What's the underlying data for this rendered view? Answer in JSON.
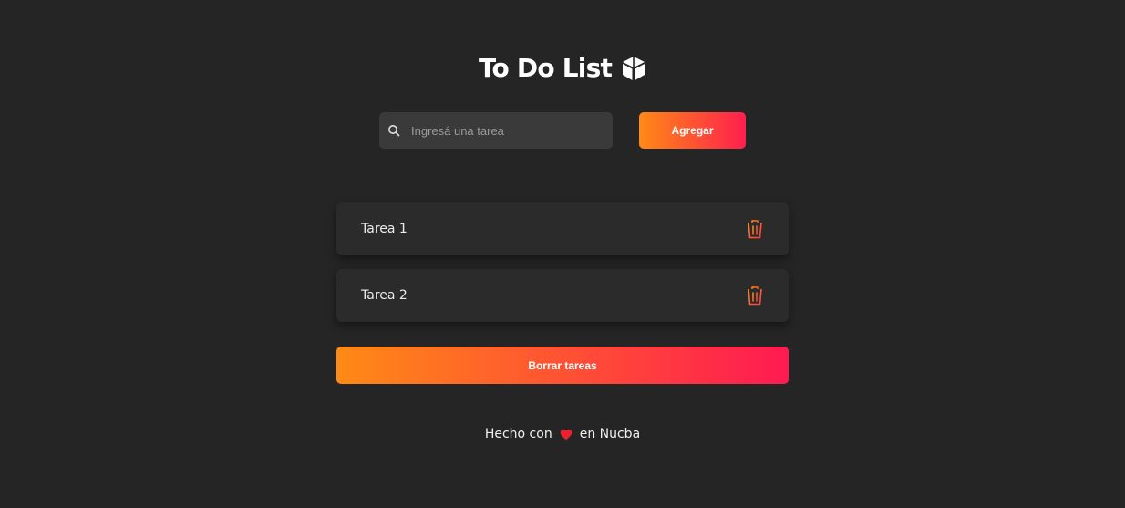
{
  "header": {
    "title": "To Do List",
    "icon": "cube-icon"
  },
  "search": {
    "placeholder": "Ingresá una tarea",
    "value": "",
    "icon": "search-icon"
  },
  "add_button": {
    "label": "Agregar"
  },
  "tasks": [
    {
      "label": "Tarea 1",
      "icon": "trash-icon"
    },
    {
      "label": "Tarea 2",
      "icon": "trash-icon"
    }
  ],
  "clear_button": {
    "label": "Borrar tareas"
  },
  "footer": {
    "prefix": "Hecho con",
    "icon": "heart-icon",
    "suffix": "en Nucba"
  },
  "colors": {
    "background": "#252525",
    "gradient_start": "#ff8a15",
    "gradient_end": "#ff1f4e",
    "heart": "#e8232f"
  }
}
